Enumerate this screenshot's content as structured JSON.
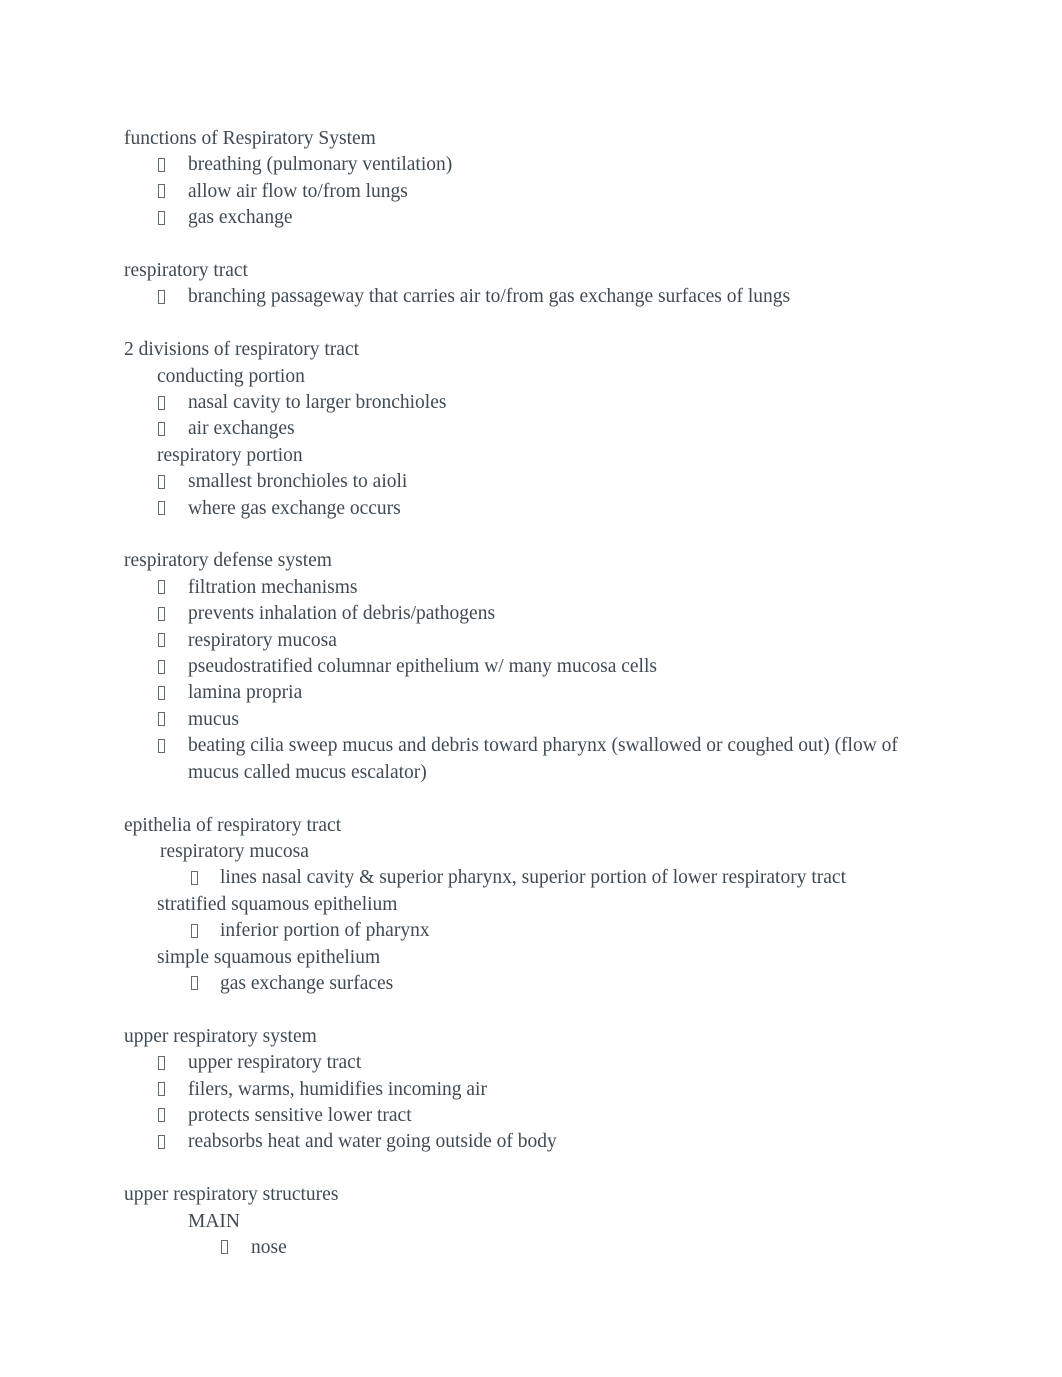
{
  "document": {
    "text_color": "#3f4a53",
    "background_color": "#ffffff",
    "bullet_glyph": "tofu-box",
    "blocks": [
      {
        "heading": "functions of Respiratory System",
        "items": [
          "breathing (pulmonary ventilation)",
          "allow air flow to/from lungs",
          "gas exchange"
        ]
      },
      {
        "heading": "respiratory tract",
        "items": [
          "branching passageway that carries air to/from gas exchange surfaces of lungs"
        ]
      },
      {
        "heading": "2 divisions of respiratory tract",
        "subheading_1": "conducting portion",
        "sub_items_1": [
          "nasal cavity to larger bronchioles",
          "air exchanges"
        ],
        "subheading_2": "respiratory portion",
        "sub_items_2": [
          "smallest bronchioles to aioli",
          "where gas exchange occurs"
        ]
      },
      {
        "heading": "respiratory defense system",
        "items": [
          "filtration mechanisms",
          "prevents inhalation of debris/pathogens",
          "respiratory mucosa",
          "pseudostratified columnar epithelium w/ many mucosa cells",
          "lamina propria",
          "mucus",
          "beating cilia sweep mucus and debris toward pharynx (swallowed or coughed out) (flow of mucus called mucus escalator)"
        ]
      },
      {
        "heading": "epithelia of respiratory tract",
        "subheading_1": "respiratory mucosa",
        "sub_items_1": [
          "lines nasal cavity & superior pharynx, superior portion of lower respiratory tract"
        ],
        "subheading_2": "stratified squamous epithelium",
        "sub_items_2": [
          "inferior portion of pharynx"
        ],
        "subheading_3": "simple squamous epithelium",
        "sub_items_3": [
          "gas exchange surfaces"
        ]
      },
      {
        "heading": "upper respiratory system",
        "items": [
          "upper respiratory tract",
          "filers, warms, humidifies incoming air",
          "protects sensitive lower tract",
          "reabsorbs heat and water going outside of body"
        ]
      },
      {
        "heading": "upper respiratory structures",
        "subheading_1": "MAIN",
        "sub_items_1": [
          "nose"
        ]
      }
    ]
  }
}
